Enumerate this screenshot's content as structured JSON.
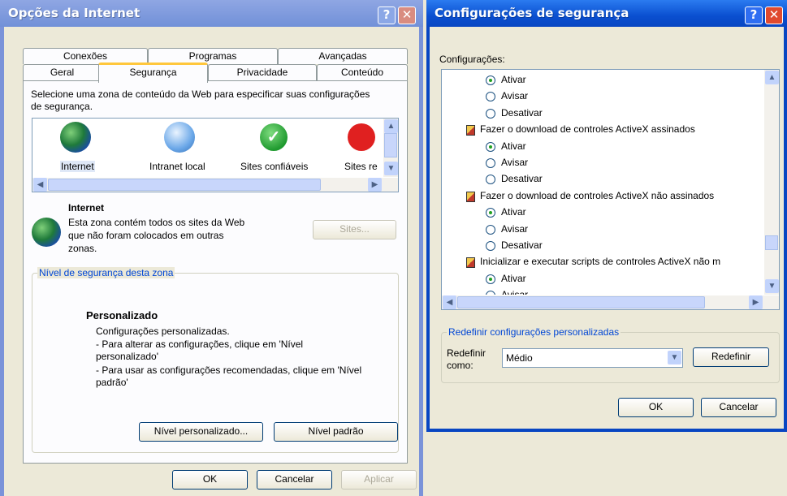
{
  "left": {
    "title": "Opções da Internet",
    "tabs_top": [
      "Conexões",
      "Programas",
      "Avançadas"
    ],
    "tabs_bottom": [
      "Geral",
      "Segurança",
      "Privacidade",
      "Conteúdo"
    ],
    "intro": "Selecione uma zona de conteúdo da Web para especificar suas configurações de segurança.",
    "zones": [
      "Internet",
      "Intranet local",
      "Sites confiáveis",
      "Sites re"
    ],
    "zone_title": "Internet",
    "zone_desc": "Esta zona contém todos os sites da Web que não foram colocados em outras zonas.",
    "sites_button": "Sites...",
    "level_group": "Nível de segurança desta zona",
    "level_title": "Personalizado",
    "level_lines": [
      "Configurações personalizadas.",
      "- Para alterar as configurações, clique em 'Nível personalizado'",
      "- Para usar as configurações recomendadas, clique em 'Nível padrão'"
    ],
    "custom_level_button": "Nível personalizado...",
    "default_level_button": "Nível padrão",
    "ok": "OK",
    "cancel": "Cancelar",
    "apply": "Aplicar"
  },
  "right": {
    "title": "Configurações de segurança",
    "settings_label": "Configurações:",
    "items": [
      {
        "type": "option",
        "label": "Ativar",
        "checked": true
      },
      {
        "type": "option",
        "label": "Avisar",
        "checked": false
      },
      {
        "type": "option",
        "label": "Desativar",
        "checked": false
      },
      {
        "type": "header",
        "label": "Fazer o download de controles ActiveX assinados"
      },
      {
        "type": "option",
        "label": "Ativar",
        "checked": true
      },
      {
        "type": "option",
        "label": "Avisar",
        "checked": false
      },
      {
        "type": "option",
        "label": "Desativar",
        "checked": false
      },
      {
        "type": "header",
        "label": "Fazer o download de controles ActiveX não assinados"
      },
      {
        "type": "option",
        "label": "Ativar",
        "checked": true
      },
      {
        "type": "option",
        "label": "Avisar",
        "checked": false
      },
      {
        "type": "option",
        "label": "Desativar",
        "checked": false
      },
      {
        "type": "header",
        "label": "Inicializar e executar scripts de controles ActiveX não m"
      },
      {
        "type": "option",
        "label": "Ativar",
        "checked": true
      },
      {
        "type": "option",
        "label": "Avisar",
        "checked": false
      }
    ],
    "reset_group": "Redefinir configurações personalizadas",
    "reset_label": "Redefinir como:",
    "reset_value": "Médio",
    "reset_button": "Redefinir",
    "ok": "OK",
    "cancel": "Cancelar"
  },
  "colors": {
    "title_gradient_top": "#0a5fd8",
    "title_gradient_bottom": "#0842a6",
    "inactive_title": "#7a96df",
    "close_red": "#e04a2f",
    "help_blue": "#2c6ef2"
  }
}
